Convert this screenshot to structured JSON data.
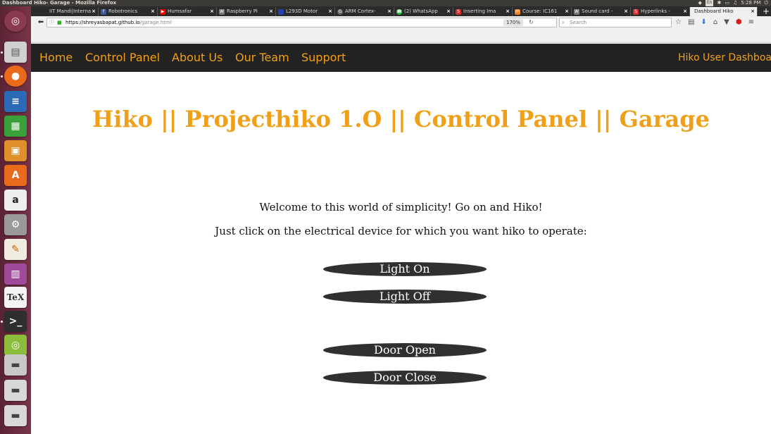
{
  "desktop": {
    "window_title": "Dashboard Hiko- Garage - Mozilla Firefox",
    "keyboard_layout": "En",
    "clock": "5:28 PM"
  },
  "browser": {
    "tabs": [
      {
        "label": "IIT Mandi|Interna",
        "favicon": "none"
      },
      {
        "label": "Robotronics",
        "favicon": "facebook"
      },
      {
        "label": "Humsafar",
        "favicon": "youtube"
      },
      {
        "label": "Raspberry Pi",
        "favicon": "wikipedia"
      },
      {
        "label": "L293D Motor",
        "favicon": "page"
      },
      {
        "label": "ARM Cortex-",
        "favicon": "google"
      },
      {
        "label": "(2) WhatsApp",
        "favicon": "whatsapp"
      },
      {
        "label": "Inserting Ima",
        "favicon": "stack"
      },
      {
        "label": "Course: IC161",
        "favicon": "moodle"
      },
      {
        "label": "Sound card -",
        "favicon": "wikipedia"
      },
      {
        "label": "Hyperlinks -",
        "favicon": "stack"
      },
      {
        "label": "Dashboard Hiko",
        "favicon": "none"
      }
    ],
    "url_host": "https://shreyasbapat.github.io",
    "url_path": "/garage.html",
    "zoom": "170%",
    "search_placeholder": "Search"
  },
  "site": {
    "nav_links": [
      "Home",
      "Control Panel",
      "About Us",
      "Our Team",
      "Support"
    ],
    "dashboard_link": "Hiko User Dashboard",
    "heading": "Hiko || Projecthiko 1.O || Control Panel || Garage",
    "welcome": "Welcome to this world of simplicity! Go on and Hiko!",
    "instruction": "Just click on the electrical device for which you want hiko to operate:",
    "buttons": {
      "light_on": "Light On",
      "light_off": "Light Off",
      "door_open": "Door Open",
      "door_close": "Door Close"
    }
  },
  "colors": {
    "accent": "#f0a018",
    "navbar": "#222222",
    "button": "#303030"
  }
}
